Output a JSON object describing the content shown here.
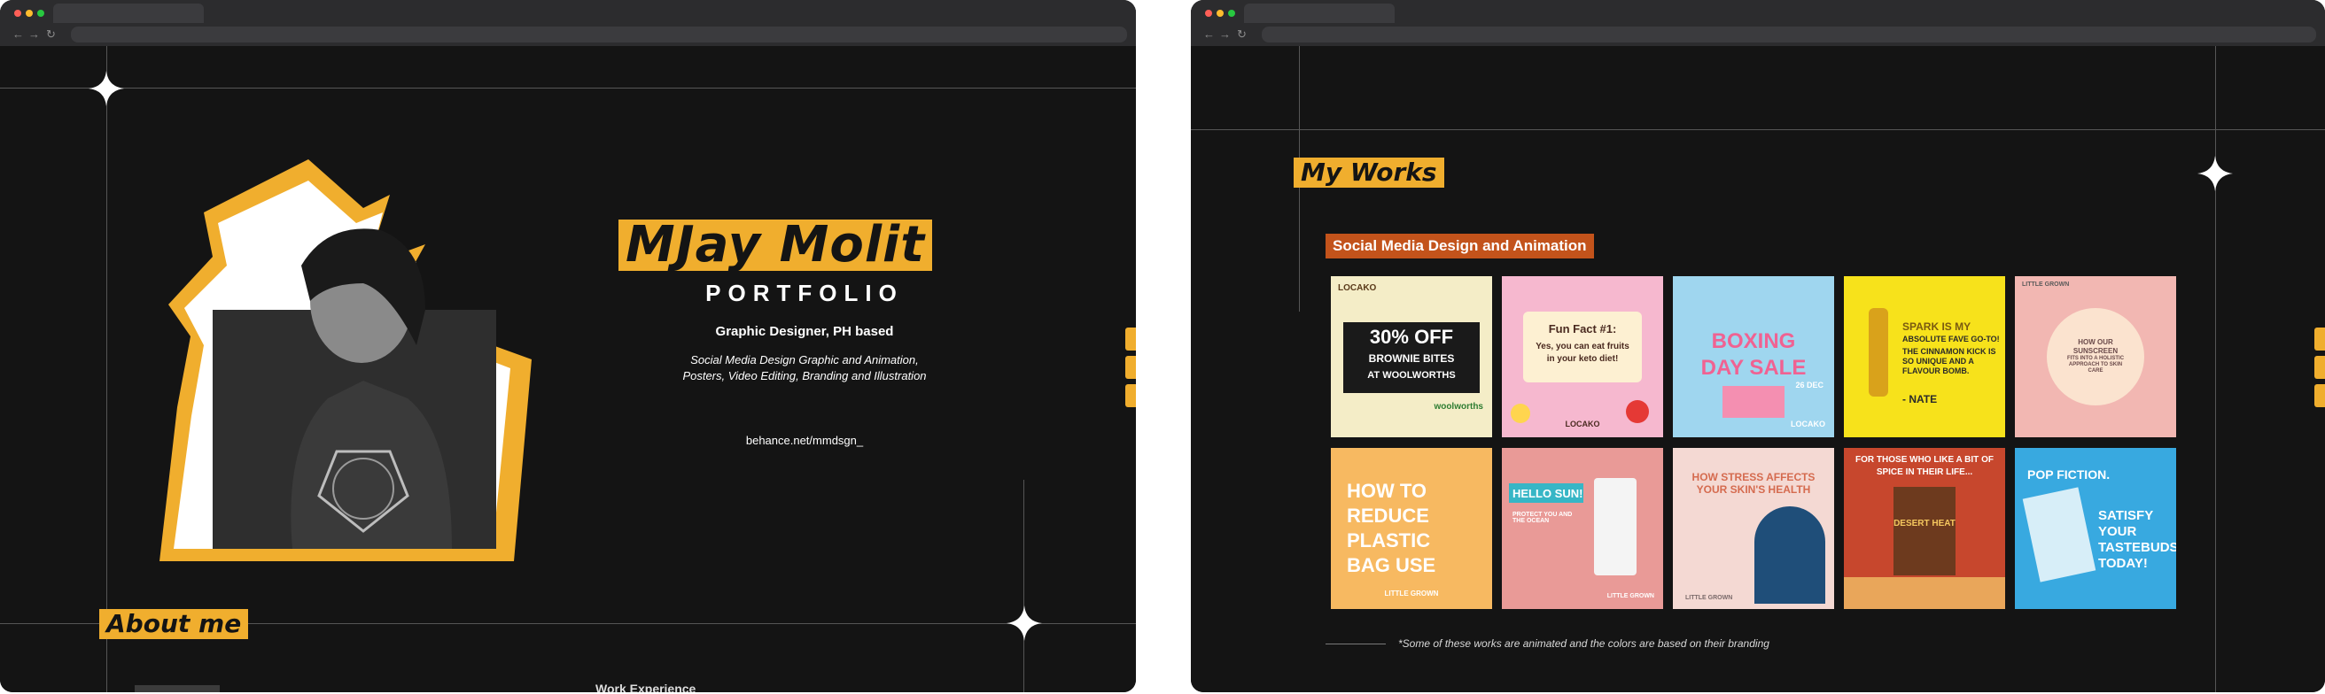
{
  "left_window": {
    "hero": {
      "name": "MJay Molit",
      "subtitle": "PORTFOLIO",
      "role": "Graphic Designer, PH based",
      "description_line1": "Social Media Design Graphic and Animation,",
      "description_line2": "Posters, Video Editing, Branding and Illustration",
      "link": "behance.net/mmdsgn_"
    },
    "about_heading": "About me",
    "next_section_heading_peek": "Work Experience"
  },
  "right_window": {
    "works_heading": "My Works",
    "section_label": "Social Media Design and Animation",
    "tiles": [
      {
        "brand": "LOCAKO",
        "text_line1": "30% OFF",
        "text_line2": "BROWNIE BITES",
        "text_line3": "AT WOOLWORTHS",
        "tag": "woolworths"
      },
      {
        "brand": "LOCAKO",
        "text_line1": "Fun Fact #1:",
        "text_line2": "Yes, you can eat fruits",
        "text_line3": "in your keto diet!"
      },
      {
        "brand": "LOCAKO",
        "text_line1": "BOXING",
        "text_line2": "DAY SALE",
        "tag": "26 DEC"
      },
      {
        "brand": "",
        "text_line1": "SPARK IS MY",
        "text_line2": "ABSOLUTE FAVE GO-TO!",
        "text_line3": "THE CINNAMON KICK IS SO UNIQUE AND A FLAVOUR BOMB.",
        "tag": "- NATE"
      },
      {
        "brand": "LITTLE GROWN",
        "text_line1": "HOW OUR",
        "text_line2": "SUNSCREEN",
        "text_line3": "FITS INTO A HOLISTIC APPROACH TO SKIN CARE"
      },
      {
        "brand": "LITTLE GROWN",
        "text_line1": "HOW TO",
        "text_line2": "REDUCE",
        "text_line3": "PLASTIC",
        "text_line4": "BAG USE"
      },
      {
        "brand": "LITTLE GROWN",
        "text_line1": "HELLO SUN!",
        "text_line2": "PROTECT YOU AND THE OCEAN"
      },
      {
        "brand": "LITTLE GROWN",
        "text_line1": "HOW STRESS AFFECTS",
        "text_line2": "YOUR SKIN'S HEALTH"
      },
      {
        "brand": "",
        "text_line1": "FOR THOSE WHO LIKE A BIT OF",
        "text_line2": "SPICE IN THEIR LIFE...",
        "text_line3": "DESERT HEAT"
      },
      {
        "brand": "",
        "text_line1": "POP FICTION.",
        "text_line2": "SATISFY",
        "text_line3": "YOUR",
        "text_line4": "TASTEBUDS",
        "text_line5": "TODAY!"
      }
    ],
    "footnote": "*Some of these works are animated and the colors are based on their branding"
  },
  "colors": {
    "accent": "#f0ae2e",
    "section_label_bg": "#c3531b",
    "background": "#141414"
  }
}
